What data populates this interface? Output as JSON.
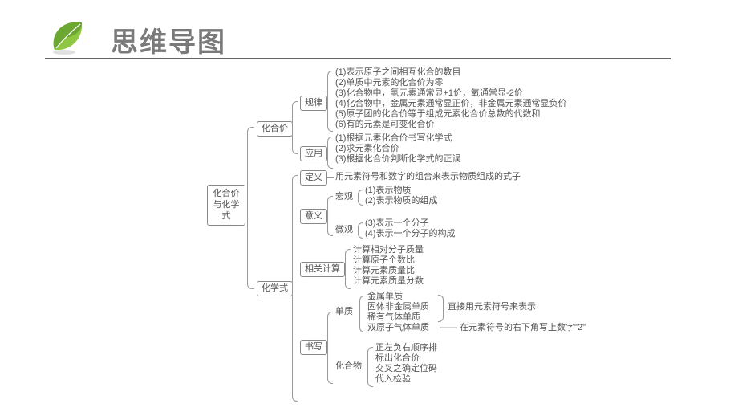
{
  "title": "思维导图",
  "root": "化合价\n与化学式",
  "branches": {
    "b1": "化合价",
    "b1a": "规律",
    "b1a_items": [
      "(1)表示原子之间相互化合的数目",
      "(2)单质中元素的化合价为零",
      "(3)化合物中，氢元素通常显+1价，氧通常显-2价",
      "(4)化合物中，金属元素通常显正价，非金属元素通常显负价",
      "(5)原子团的化合价等于组成元素化合价总数的代数和",
      "(6)有的元素是可变化合价"
    ],
    "b1b": "应用",
    "b1b_items": [
      "(1)根据元素化合价书写化学式",
      "(2)求元素化合价",
      "(3)根据化合价判断化学式的正误"
    ],
    "b2": "化学式",
    "b2a": "定义",
    "b2a_text": "用元素符号和数字的组合来表示物质组成的式子",
    "b2b": "意义",
    "b2b_macro": "宏观",
    "b2b_macro_items": [
      "(1)表示物质",
      "(2)表示物质的组成"
    ],
    "b2b_micro": "微观",
    "b2b_micro_items": [
      "(3)表示一个分子",
      "(4)表示一个分子的构成"
    ],
    "b2c": "相关计算",
    "b2c_items": [
      "计算相对分子质量",
      "计算原子个数比",
      "计算元素质量比",
      "计算元素质量分数"
    ],
    "b2d": "书写",
    "b2d_simple": "单质",
    "b2d_simple_items": [
      "金属单质",
      "固体非金属单质",
      "稀有气体单质",
      "双原子气体单质"
    ],
    "b2d_simple_note1": "直接用元素符号来表示",
    "b2d_simple_note2": "在元素符号的右下角写上数字\"2\"",
    "b2d_compound": "化合物",
    "b2d_compound_items": [
      "正左负右顺序排",
      "标出化合价",
      "交叉之确定位码",
      "代入检验"
    ]
  }
}
